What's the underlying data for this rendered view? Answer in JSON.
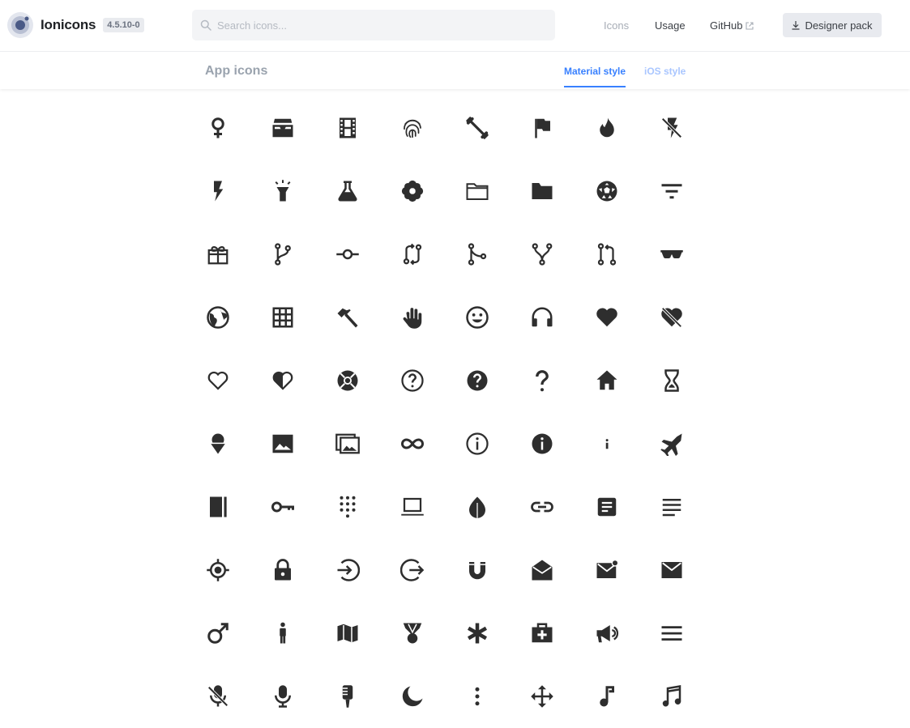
{
  "brand": {
    "name": "Ionicons",
    "version": "4.5.10-0",
    "logo_icon": "ionic-logo-icon"
  },
  "search": {
    "placeholder": "Search icons..."
  },
  "nav": {
    "icons": "Icons",
    "usage": "Usage",
    "github": "GitHub",
    "designer_pack": "Designer pack"
  },
  "section": {
    "title": "App icons"
  },
  "tabs": {
    "material": "Material style",
    "ios": "iOS style",
    "active": "material"
  },
  "colors": {
    "accent": "#3880ff",
    "icon": "#2e2e2e"
  },
  "icons": [
    "female-icon",
    "filing-icon",
    "film-icon",
    "finger-print-icon",
    "fitness-icon",
    "flag-icon",
    "flame-icon",
    "flash-off-icon",
    "flash-icon",
    "flashlight-icon",
    "flask-icon",
    "flower-icon",
    "folder-open-icon",
    "folder-icon",
    "football-icon",
    "funnel-icon",
    "gift-icon",
    "git-branch-icon",
    "git-commit-icon",
    "git-compare-icon",
    "git-merge-icon",
    "git-network-icon",
    "git-pull-request-icon",
    "glasses-icon",
    "globe-icon",
    "grid-icon",
    "hammer-icon",
    "hand-icon",
    "happy-icon",
    "headset-icon",
    "heart-icon",
    "heart-dislike-icon",
    "heart-empty-icon",
    "heart-half-icon",
    "help-buoy-icon",
    "help-circle-outline-icon",
    "help-circle-icon",
    "help-icon",
    "home-icon",
    "hourglass-icon",
    "ice-cream-icon",
    "image-icon",
    "images-icon",
    "infinite-icon",
    "information-circle-outline-icon",
    "information-circle-icon",
    "information-icon",
    "jet-icon",
    "journal-icon",
    "key-icon",
    "keypad-icon",
    "laptop-icon",
    "leaf-icon",
    "link-icon",
    "list-box-icon",
    "list-icon",
    "locate-icon",
    "lock-icon",
    "log-in-icon",
    "log-out-icon",
    "magnet-icon",
    "mail-open-icon",
    "mail-unread-icon",
    "mail-icon",
    "male-icon",
    "man-icon",
    "map-icon",
    "medal-icon",
    "medical-icon",
    "medkit-icon",
    "megaphone-icon",
    "menu-icon",
    "mic-off-icon",
    "mic-icon",
    "microphone-icon",
    "moon-icon",
    "more-icon",
    "move-icon",
    "musical-note-icon",
    "musical-notes-icon"
  ]
}
